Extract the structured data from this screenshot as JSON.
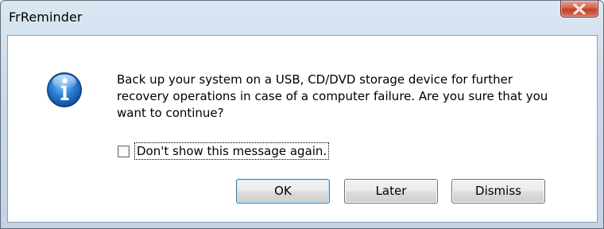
{
  "window": {
    "title": "FrReminder"
  },
  "icons": {
    "info": "info-icon",
    "close": "close-icon"
  },
  "dialog": {
    "message": "Back up your system on a USB, CD/DVD storage device for further recovery operations in case of a computer failure. Are you sure that you want to continue?",
    "checkbox_label": "Don't show this message again.",
    "checkbox_checked": false
  },
  "buttons": {
    "ok": "OK",
    "later": "Later",
    "dismiss": "Dismiss"
  },
  "colors": {
    "titlebar": "#cbd9e8",
    "close_button": "#c94a31",
    "info_icon": "#1e6fc0"
  }
}
